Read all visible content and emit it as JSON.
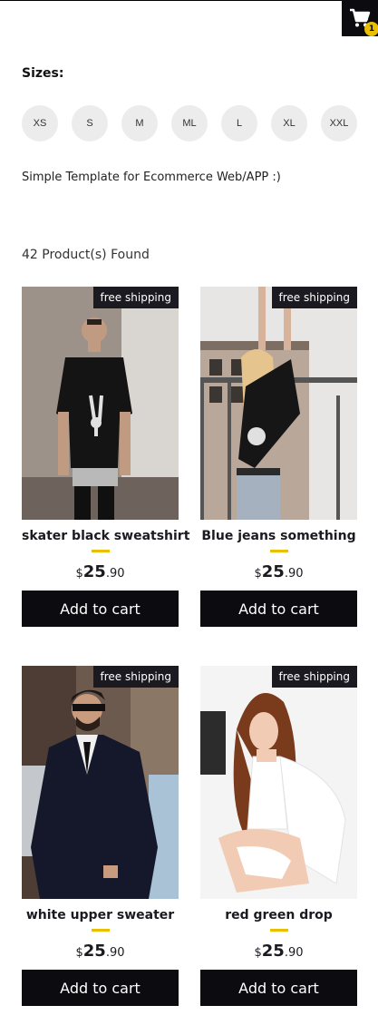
{
  "header": {
    "cart_count": "1",
    "cart_icon": "shopping-cart-icon"
  },
  "filters": {
    "title": "Sizes:",
    "sizes": [
      "XS",
      "S",
      "M",
      "ML",
      "L",
      "XL",
      "XXL"
    ]
  },
  "tagline": "Simple Template for Ecommerce Web/APP :)",
  "results": {
    "count_text": "42 Product(s) Found"
  },
  "products": [
    {
      "tag": "free shipping",
      "title": "skater black sweatshirt",
      "currency": "$",
      "price_int": "25",
      "price_dec": ".90",
      "button": "Add to cart"
    },
    {
      "tag": "free shipping",
      "title": "Blue jeans something",
      "currency": "$",
      "price_int": "25",
      "price_dec": ".90",
      "button": "Add to cart"
    },
    {
      "tag": "free shipping",
      "title": "white upper sweater",
      "currency": "$",
      "price_int": "25",
      "price_dec": ".90",
      "button": "Add to cart"
    },
    {
      "tag": "free shipping",
      "title": "red green drop",
      "currency": "$",
      "price_int": "25",
      "price_dec": ".90",
      "button": "Add to cart"
    }
  ],
  "colors": {
    "accent": "#eabf00",
    "dark": "#0c0b10"
  }
}
